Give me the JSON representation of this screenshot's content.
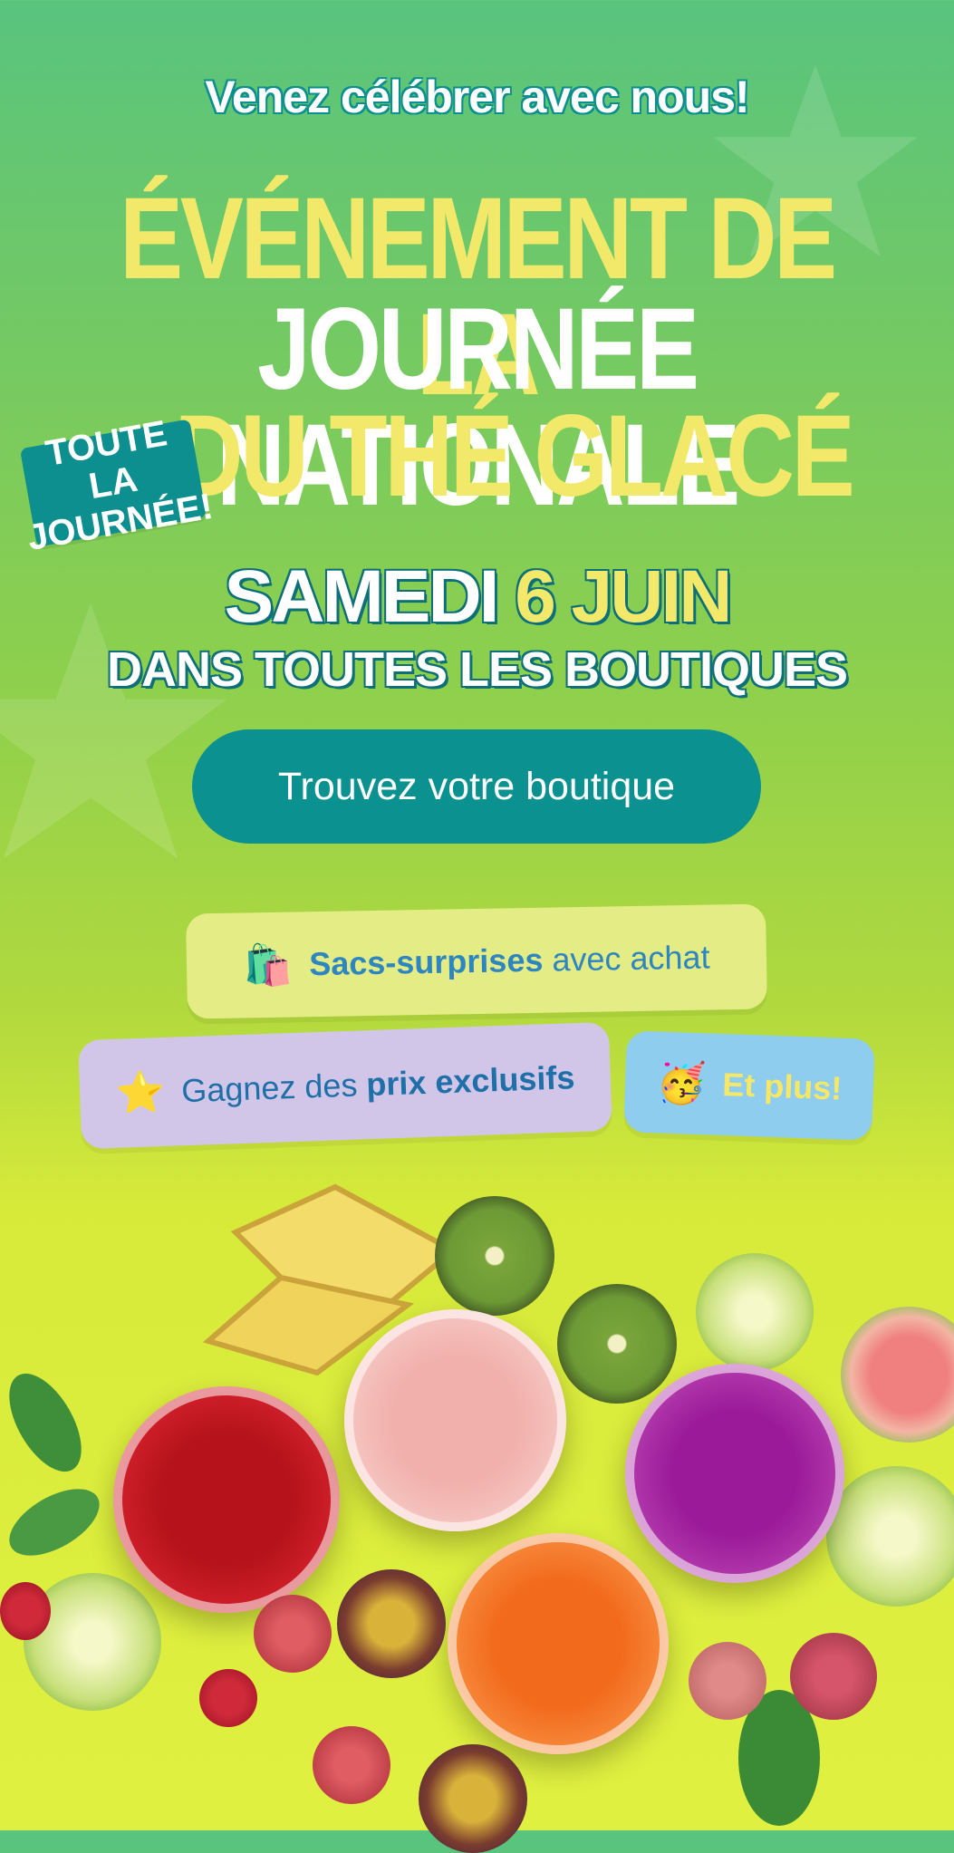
{
  "header": {
    "subtitle": "Venez célébrer avec nous!",
    "title_line1": "ÉVÉNEMENT DE LA",
    "title_line2": "JOURNÉE NATIONALE",
    "title_line3": "DU THÉ GLACÉ",
    "tag_line1": "TOUTE LA",
    "tag_line2": "JOURNÉE!"
  },
  "event": {
    "day": "SAMEDI",
    "date": "6 JUIN",
    "location": "DANS TOUTES LES BOUTIQUES"
  },
  "cta": {
    "label": "Trouvez votre boutique"
  },
  "perks": {
    "bags": {
      "emoji": "🛍️",
      "bold": "Sacs-surprises",
      "text": " avec achat"
    },
    "prizes": {
      "emoji": "⭐",
      "text": "Gagnez des ",
      "bold": "prix exclusifs"
    },
    "more": {
      "emoji": "🥳",
      "text": "Et plus!"
    }
  },
  "colors": {
    "teal": "#0c9191",
    "yellow": "#f2e96a",
    "bg_green": "#73c964",
    "bg_lime": "#e0f040"
  }
}
